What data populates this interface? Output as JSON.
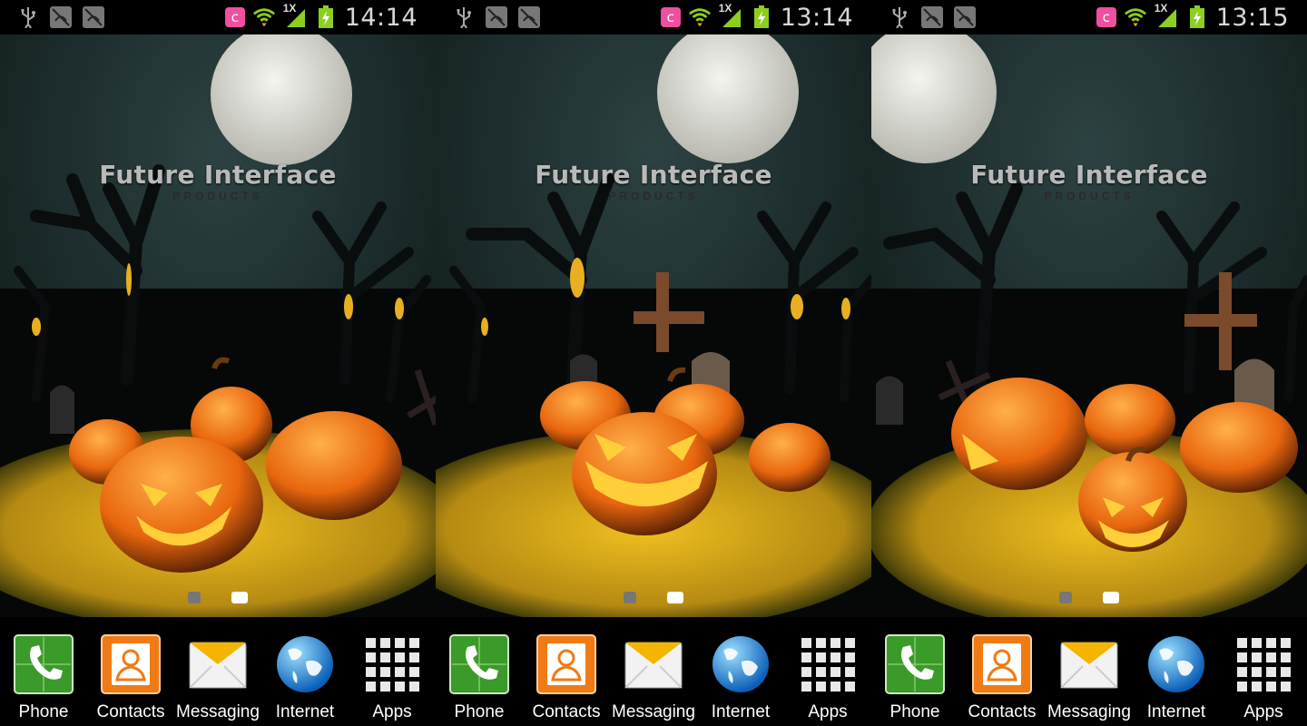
{
  "screens": [
    {
      "clock": "14:14",
      "net_badge": "1X",
      "brand": {
        "title": "Future Interface",
        "subtitle": "PRODUCTS"
      },
      "pager": {
        "current_page": 2,
        "page_count": 2
      },
      "dock": [
        {
          "label": "Phone",
          "icon": "phone-icon"
        },
        {
          "label": "Contacts",
          "icon": "contacts-icon"
        },
        {
          "label": "Messaging",
          "icon": "envelope-icon"
        },
        {
          "label": "Internet",
          "icon": "globe-icon"
        },
        {
          "label": "Apps",
          "icon": "app-grid-icon"
        }
      ]
    },
    {
      "clock": "13:14",
      "net_badge": "1X",
      "brand": {
        "title": "Future Interface",
        "subtitle": "PRODUCTS"
      },
      "pager": {
        "current_page": 2,
        "page_count": 2
      },
      "dock": [
        {
          "label": "Phone",
          "icon": "phone-icon"
        },
        {
          "label": "Contacts",
          "icon": "contacts-icon"
        },
        {
          "label": "Messaging",
          "icon": "envelope-icon"
        },
        {
          "label": "Internet",
          "icon": "globe-icon"
        },
        {
          "label": "Apps",
          "icon": "app-grid-icon"
        }
      ]
    },
    {
      "clock": "13:15",
      "net_badge": "1X",
      "brand": {
        "title": "Future Interface",
        "subtitle": "PRODUCTS"
      },
      "pager": {
        "current_page": 2,
        "page_count": 2
      },
      "dock": [
        {
          "label": "Phone",
          "icon": "phone-icon"
        },
        {
          "label": "Contacts",
          "icon": "contacts-icon"
        },
        {
          "label": "Messaging",
          "icon": "envelope-icon"
        },
        {
          "label": "Internet",
          "icon": "globe-icon"
        },
        {
          "label": "Apps",
          "icon": "app-grid-icon"
        }
      ]
    }
  ],
  "colors": {
    "pumpkin": "#f07a14",
    "sky": "#1a2b2c",
    "grass": "#d6a81a",
    "badge_pink": "#ee4f9f",
    "battery_green": "#8ccf1e"
  }
}
